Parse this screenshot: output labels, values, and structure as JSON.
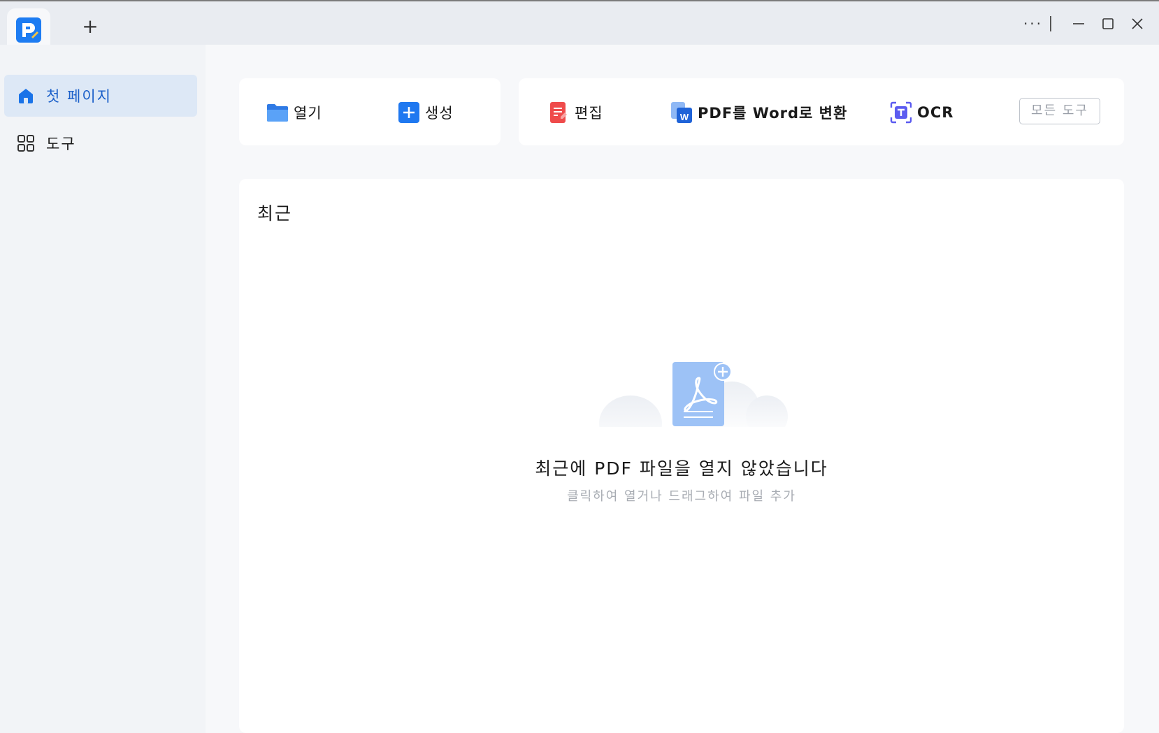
{
  "titlebar": {
    "new_tab": "+",
    "more": "···",
    "minimize_icon": "minimize-icon",
    "maximize_icon": "maximize-icon",
    "close_icon": "close-icon"
  },
  "sidebar": {
    "items": [
      {
        "label": "첫 페이지",
        "icon": "home-icon",
        "active": true
      },
      {
        "label": "도구",
        "icon": "grid-icon",
        "active": false
      }
    ]
  },
  "quick_actions": {
    "open": {
      "label": "열기",
      "icon": "folder-icon"
    },
    "create": {
      "label": "생성",
      "icon": "plus-square-icon"
    },
    "edit": {
      "label": "편집",
      "icon": "edit-doc-icon"
    },
    "pdf_to_word": {
      "label": "PDF를 Word로 변환",
      "icon": "word-convert-icon"
    },
    "ocr": {
      "label": "OCR",
      "icon": "ocr-icon"
    },
    "all_tools": "모든 도구"
  },
  "recent": {
    "title": "최근",
    "empty_title": "최근에 PDF 파일을 열지 않았습니다",
    "empty_subtitle": "클릭하여 열거나 드래그하여 파일 추가"
  },
  "colors": {
    "accent": "#1a5fc9",
    "active_nav_bg": "#dde8f6",
    "edit_red": "#ef4b4b",
    "ocr_purple": "#5b5bf0",
    "folder_blue": "#3c8cf0"
  }
}
